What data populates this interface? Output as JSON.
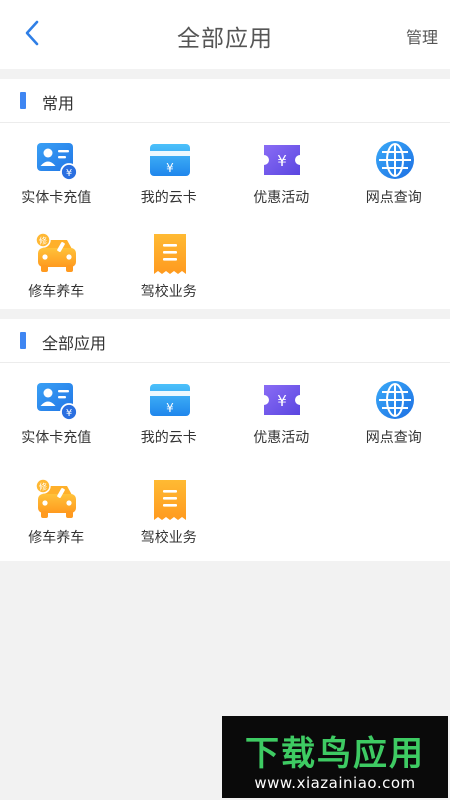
{
  "header": {
    "title": "全部应用",
    "manage_label": "管理",
    "back_icon": "chevron-left-icon"
  },
  "sections": [
    {
      "title": "常用",
      "apps": [
        {
          "label": "实体卡充值",
          "icon": "id-card-recharge-icon"
        },
        {
          "label": "我的云卡",
          "icon": "cloud-card-icon"
        },
        {
          "label": "优惠活动",
          "icon": "coupon-icon"
        },
        {
          "label": "网点查询",
          "icon": "globe-icon"
        },
        {
          "label": "修车养车",
          "icon": "car-repair-icon"
        },
        {
          "label": "驾校业务",
          "icon": "receipt-icon"
        }
      ]
    },
    {
      "title": "全部应用",
      "apps": [
        {
          "label": "实体卡充值",
          "icon": "id-card-recharge-icon"
        },
        {
          "label": "我的云卡",
          "icon": "cloud-card-icon"
        },
        {
          "label": "优惠活动",
          "icon": "coupon-icon"
        },
        {
          "label": "网点查询",
          "icon": "globe-icon"
        },
        {
          "label": "修车养车",
          "icon": "car-repair-icon"
        },
        {
          "label": "驾校业务",
          "icon": "receipt-icon"
        }
      ]
    }
  ],
  "watermark": {
    "logo": "下载鸟应用",
    "url": "www.xiazainiao.com"
  },
  "colors": {
    "accent": "#3f86f2",
    "watermark_green": "#3ecb63"
  }
}
